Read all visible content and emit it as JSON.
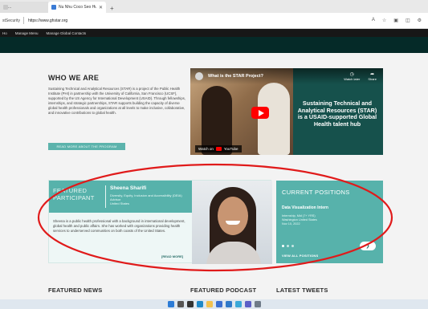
{
  "browser": {
    "tabs": [
      {
        "label": "...",
        "active": false,
        "favicon_color": "#c8c8c8"
      },
      {
        "label": "Nu Nhu Coco Seo Hu 85 coca",
        "active": true,
        "favicon_color": "#3a7bd5"
      }
    ],
    "new_tab_glyph": "+",
    "address_label": "stSecurity",
    "url": "https://www.ghstar.org",
    "toolbar_icons": [
      "translate-icon",
      "favorite-icon",
      "collections-icon",
      "split-icon",
      "settings-icon"
    ]
  },
  "site_nav": {
    "items": [
      "Ho",
      "Manage Menu",
      "Manage Global Contacts"
    ]
  },
  "who_we_are": {
    "title": "WHO WE ARE",
    "body": "Sustaining Technical and Analytical Resources (STAR) is a project of the Public Health Institute (PHI) in partnership with the University of California, San Francisco (UCSF), supported by the US Agency for International Development (USAID). Through fellowships, internships, and strategic partnerships, STAR supports building the capacity of diverse global health professionals and organizations at all levels to make inclusive, collaborative, and innovative contributions to global health.",
    "button": "READ MORE ABOUT THE PROGRAM"
  },
  "video": {
    "title": "What is the STAR Project?",
    "heading": "Sustaining Technical and Analytical Resources (STAR) is a USAID-supported Global Health talent hub",
    "watch_later": "Watch later",
    "share": "Share",
    "watch_on": "Watch on",
    "youtube": "YouTube",
    "colors": {
      "panel": "#16514c",
      "play": "#ff0000"
    }
  },
  "featured_participant": {
    "label_line1": "FEATURED",
    "label_line2": "PARTICIPANT",
    "name": "Sheena Sharifi",
    "role": "Diversity, Equity, Inclusion and Accessibility (DEIA) Advisor",
    "location": "United States",
    "bio": "Sheena is a public health professional with a background in international development, global health and public affairs. She has worked with organizations providing health services to underserved communities on both coasts of the United States.",
    "more": "[READ MORE]",
    "colors": {
      "header": "#57b2ab",
      "panel": "#eef7f6"
    }
  },
  "current_positions": {
    "title": "CURRENT POSITIONS",
    "job_title": "Data Visualization Intern",
    "meta_line1": "Internship, Mid (7+ YRS)",
    "meta_line2": "Washington United States",
    "meta_line3": "Nov 10, 2022",
    "view_all": "VIEW ALL POSITIONS",
    "next_glyph": "❯",
    "carousel": {
      "count": 3,
      "active_index": 0
    },
    "colors": {
      "panel": "#57b2ab"
    }
  },
  "sections": {
    "news": "FEATURED NEWS",
    "podcast": "FEATURED PODCAST",
    "tweets": "LATEST TWEETS"
  },
  "taskbar": {
    "icons": [
      {
        "name": "windows-start-icon",
        "color": "#2b7bd6"
      },
      {
        "name": "search-icon",
        "color": "#555555"
      },
      {
        "name": "task-view-icon",
        "color": "#333333"
      },
      {
        "name": "edge-icon",
        "color": "#1e88c8"
      },
      {
        "name": "file-explorer-icon",
        "color": "#f2c14e"
      },
      {
        "name": "store-icon",
        "color": "#3b6fd0"
      },
      {
        "name": "mail-icon",
        "color": "#2f79c9"
      },
      {
        "name": "photos-icon",
        "color": "#3aa8d8"
      },
      {
        "name": "teams-icon",
        "color": "#5b5fc7"
      },
      {
        "name": "settings-icon",
        "color": "#6f7b88"
      }
    ]
  },
  "annotation": {
    "color": "#e01a1a"
  }
}
